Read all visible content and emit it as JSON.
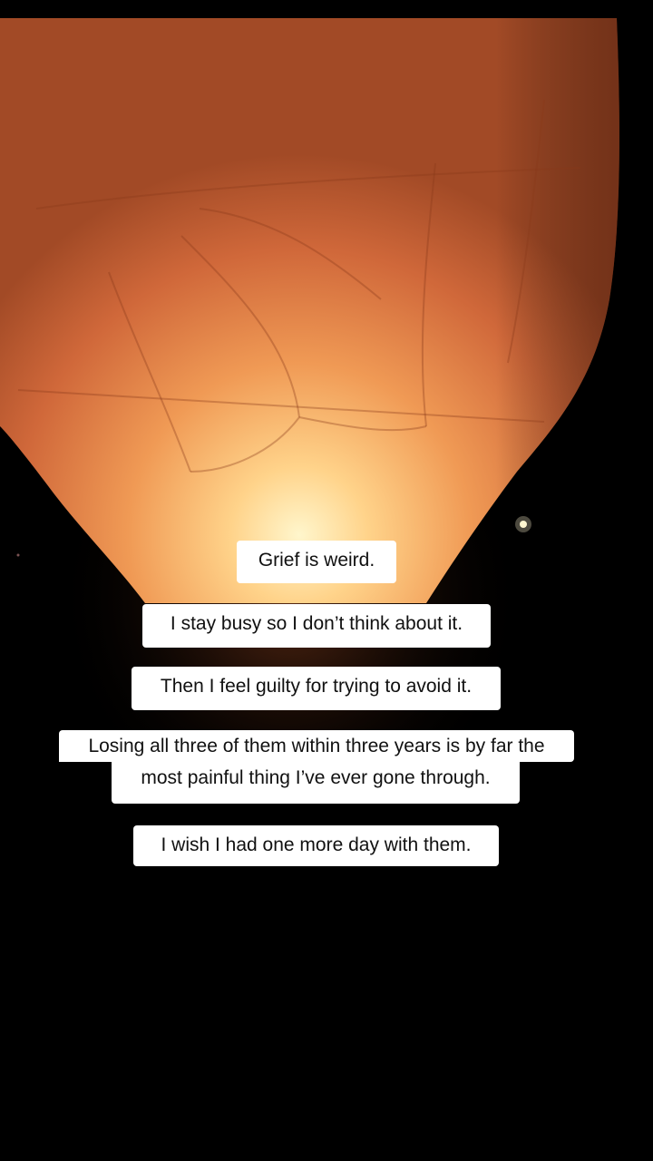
{
  "background": {
    "subject": "paper-sky-lantern",
    "lantern_color": "#e07a3a",
    "glow_color": "#fff3c0",
    "sky_color": "#000000"
  },
  "captions": {
    "line1": "Grief is weird.",
    "line2": "I stay busy so I don’t think about it.",
    "line3": "Then I feel guilty for trying to avoid it.",
    "line4a": "Losing all three of them within three years is by far the",
    "line4b": "most painful thing I’ve ever gone through.",
    "line5": "I wish I had one more day with them."
  }
}
